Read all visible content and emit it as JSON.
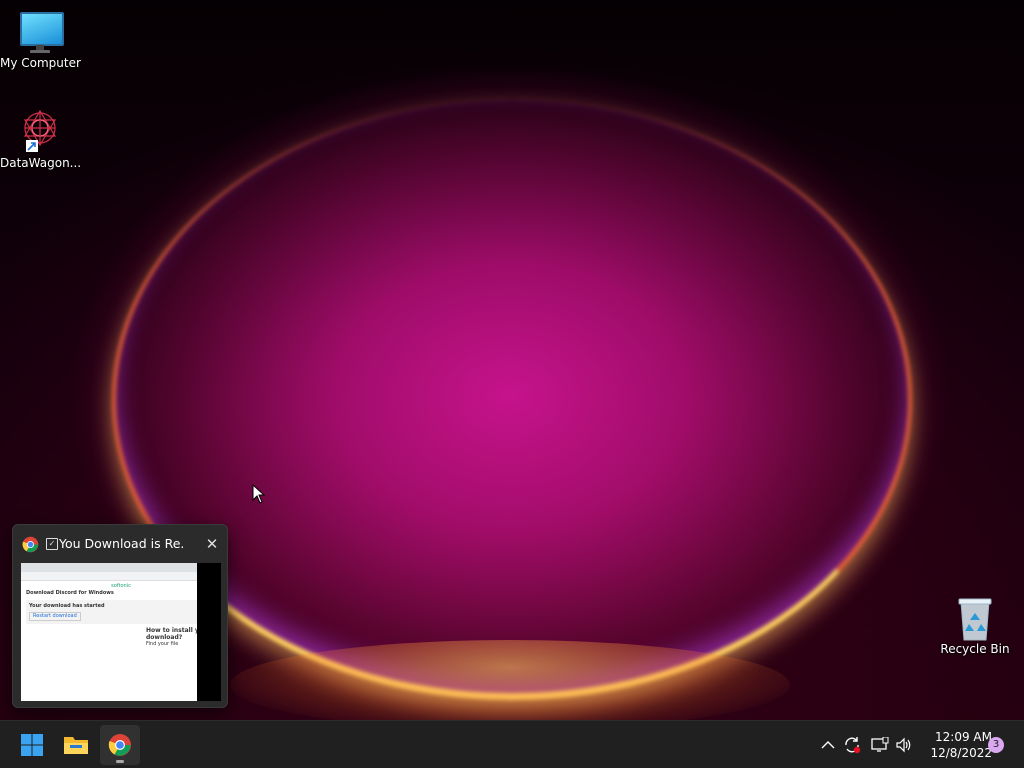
{
  "desktop": {
    "icons": [
      {
        "label": "My Computer",
        "icon": "computer-icon"
      },
      {
        "label": "DataWagon...",
        "icon": "datawagon-icon"
      },
      {
        "label": "Recycle Bin",
        "icon": "recycle-bin-icon"
      }
    ]
  },
  "preview": {
    "app_icon": "chrome-icon",
    "title": "You Download is Re...",
    "close_icon": "close-icon",
    "thumbnail": {
      "site": "softonic",
      "heading": "Download Discord for Windows",
      "status": "Your download has started",
      "button": "Restart download",
      "side_heading": "How to install your download?",
      "side_sub": "Find your file"
    }
  },
  "taskbar": {
    "start": "start-icon",
    "apps": [
      "file-explorer-icon",
      "chrome-icon"
    ]
  },
  "tray": {
    "icons": [
      "chevron-up-icon",
      "sync-icon",
      "display-icon",
      "volume-icon"
    ],
    "time": "12:09 AM",
    "date": "12/8/2022",
    "notifications": "3"
  }
}
